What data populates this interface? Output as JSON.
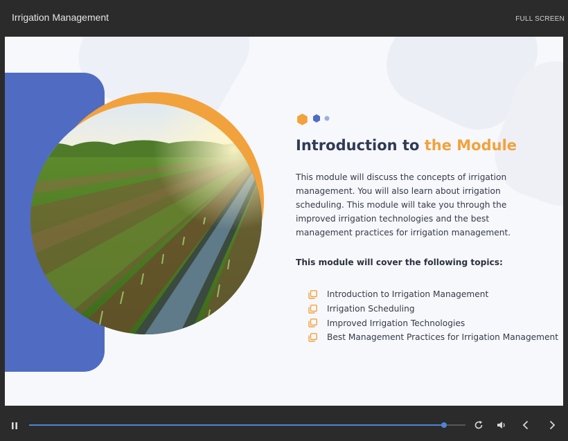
{
  "header": {
    "title": "Irrigation Management",
    "fullscreen_label": "FULL SCREEN"
  },
  "slide": {
    "title_plain": "Introduction to ",
    "title_accent": "the Module",
    "description": "This module will discuss the concepts of irrigation management. You will also learn about irrigation scheduling. This module will take you through the improved irrigation technologies and the best management practices for irrigation management.",
    "topics_heading": "This module will cover the following topics:",
    "topics": [
      "Introduction to Irrigation Management",
      "Irrigation Scheduling",
      "Improved Irrigation Technologies",
      "Best Management Practices for Irrigation Management"
    ],
    "photo_icon": "crop-field-photo",
    "topic_icon": "copy-icon"
  },
  "player": {
    "progress": 0.95,
    "icons": [
      "pause-icon",
      "replay-icon",
      "volume-icon",
      "previous-icon",
      "next-icon"
    ]
  },
  "colors": {
    "accent_orange": "#f2a23c",
    "accent_blue": "#4f6cc2",
    "progress_blue": "#4f84d6",
    "title_dark": "#2f3b55"
  }
}
